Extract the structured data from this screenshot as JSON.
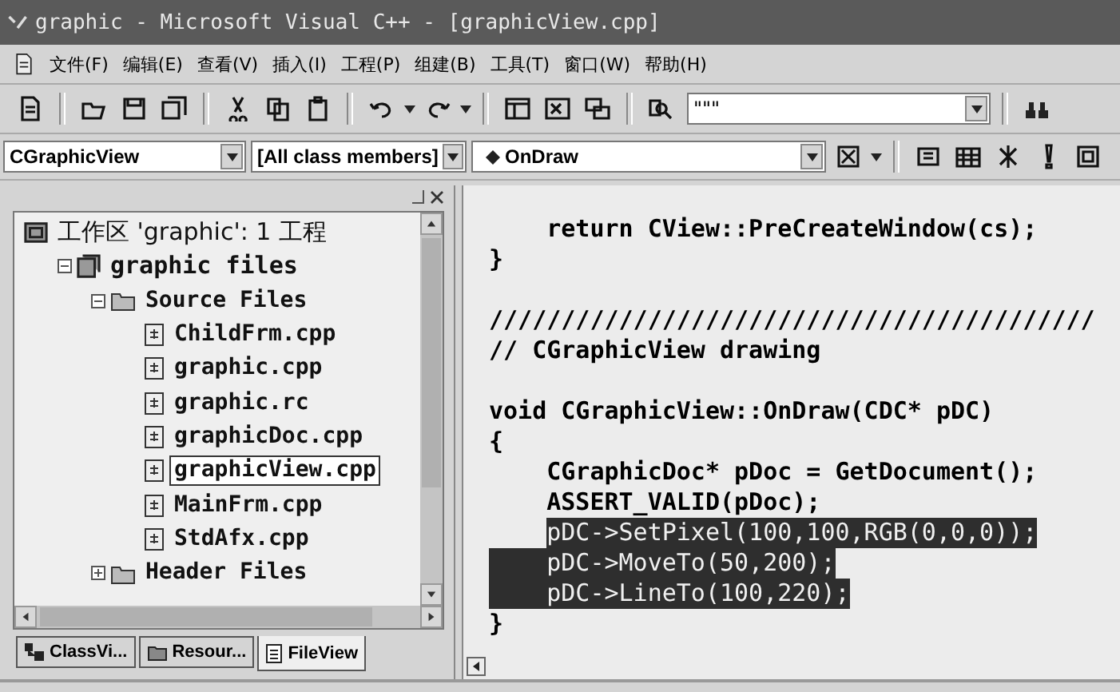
{
  "window": {
    "title": "graphic - Microsoft Visual C++ - [graphicView.cpp]"
  },
  "menu": [
    "文件(F)",
    "编辑(E)",
    "查看(V)",
    "插入(I)",
    "工程(P)",
    "组建(B)",
    "工具(T)",
    "窗口(W)",
    "帮助(H)"
  ],
  "find_combo": {
    "value": "\"\"\""
  },
  "wizard_bar": {
    "class": "CGraphicView",
    "filter": "[All class members]",
    "member": "OnDraw"
  },
  "workspace": {
    "tree": [
      {
        "label": "工作区 'graphic': 1 工程",
        "kind": "workspace",
        "children": [
          {
            "label": "graphic files",
            "kind": "project",
            "expanded": true,
            "children": [
              {
                "label": "Source Files",
                "kind": "folder",
                "expanded": true,
                "children": [
                  {
                    "label": "ChildFrm.cpp",
                    "kind": "file",
                    "selected": false
                  },
                  {
                    "label": "graphic.cpp",
                    "kind": "file",
                    "selected": false
                  },
                  {
                    "label": "graphic.rc",
                    "kind": "file",
                    "selected": false
                  },
                  {
                    "label": "graphicDoc.cpp",
                    "kind": "file",
                    "selected": false
                  },
                  {
                    "label": "graphicView.cpp",
                    "kind": "file",
                    "selected": true
                  },
                  {
                    "label": "MainFrm.cpp",
                    "kind": "file",
                    "selected": false
                  },
                  {
                    "label": "StdAfx.cpp",
                    "kind": "file",
                    "selected": false
                  }
                ]
              },
              {
                "label": "Header Files",
                "kind": "folder",
                "expanded": false
              }
            ]
          }
        ]
      }
    ],
    "tabs": [
      {
        "label": "ClassVi...",
        "kind": "class",
        "selected": false
      },
      {
        "label": "Resour...",
        "kind": "resource",
        "selected": false
      },
      {
        "label": "FileView",
        "kind": "file",
        "selected": true
      }
    ]
  },
  "editor": {
    "blocks": [
      [
        {
          "text": "    return CView::PreCreateWindow(cs);",
          "selected": false
        },
        {
          "text": "}",
          "selected": false
        }
      ],
      [
        {
          "text": "//////////////////////////////////////////",
          "selected": false
        },
        {
          "text": "// CGraphicView drawing",
          "selected": false
        }
      ],
      [
        {
          "text": "void CGraphicView::OnDraw(CDC* pDC)",
          "selected": false
        },
        {
          "text": "{",
          "selected": false
        },
        {
          "text": "    CGraphicDoc* pDoc = GetDocument();",
          "selected": false
        },
        {
          "text": "    ASSERT_VALID(pDoc);",
          "selected": false
        },
        {
          "text": "    pDC->SetPixel(100,100,RGB(0,0,0));",
          "selected": true,
          "indent_selected": false
        },
        {
          "text": "    pDC->MoveTo(50,200);",
          "selected": true,
          "indent_selected": true
        },
        {
          "text": "    pDC->LineTo(100,220);",
          "selected": true,
          "indent_selected": true
        },
        {
          "text": "}",
          "selected": false
        }
      ]
    ]
  }
}
